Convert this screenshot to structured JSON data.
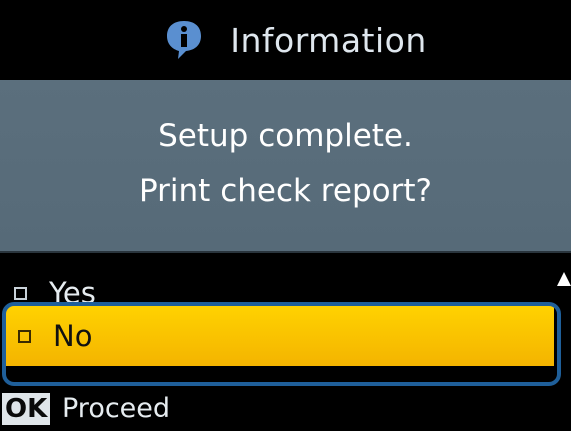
{
  "title_bar": {
    "icon": "info-speech-bubble-icon",
    "title": "Information"
  },
  "message": {
    "line1": "Setup complete.",
    "line2": "Print check report?"
  },
  "menu": {
    "items": [
      {
        "label": "Yes",
        "selected": false
      },
      {
        "label": "No",
        "selected": true
      }
    ]
  },
  "hint": {
    "key": "OK",
    "action": "Proceed"
  },
  "colors": {
    "highlight": "#F4B400",
    "selection_outline": "#1F5F9A",
    "message_bg": "#5B6F7D"
  }
}
